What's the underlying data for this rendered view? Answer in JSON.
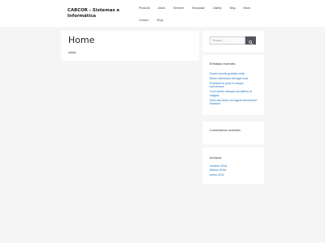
{
  "site": {
    "title": "CABCOR - Sistemas e Informática"
  },
  "nav": {
    "row1": [
      "Products",
      "About",
      "Services",
      "Showcase",
      "Gallery",
      "Blog",
      "News"
    ],
    "row2": [
      "Contact",
      "Shop"
    ]
  },
  "main": {
    "title": "Home",
    "body": "sebbs"
  },
  "search": {
    "placeholder": "Buscar ..."
  },
  "recent_posts": {
    "title": "Entradas recientes",
    "items": [
      "Donec iaculis gravida nulla",
      "Etiam bibendum elit eget erat",
      "Praesent id justo in neque elementum",
      "Cum sociis natoque penatibus et magnis",
      "Nam sed tellus id magna elementum tincidunt"
    ]
  },
  "recent_comments": {
    "title": "Comentarios recientes"
  },
  "archives": {
    "title": "Archivos",
    "items": [
      "octubre 2018",
      "febrero 2016",
      "enero 2011"
    ]
  },
  "colors": {
    "link": "#1e73be",
    "search_button": "#55555e",
    "background": "#f5f5f5"
  }
}
